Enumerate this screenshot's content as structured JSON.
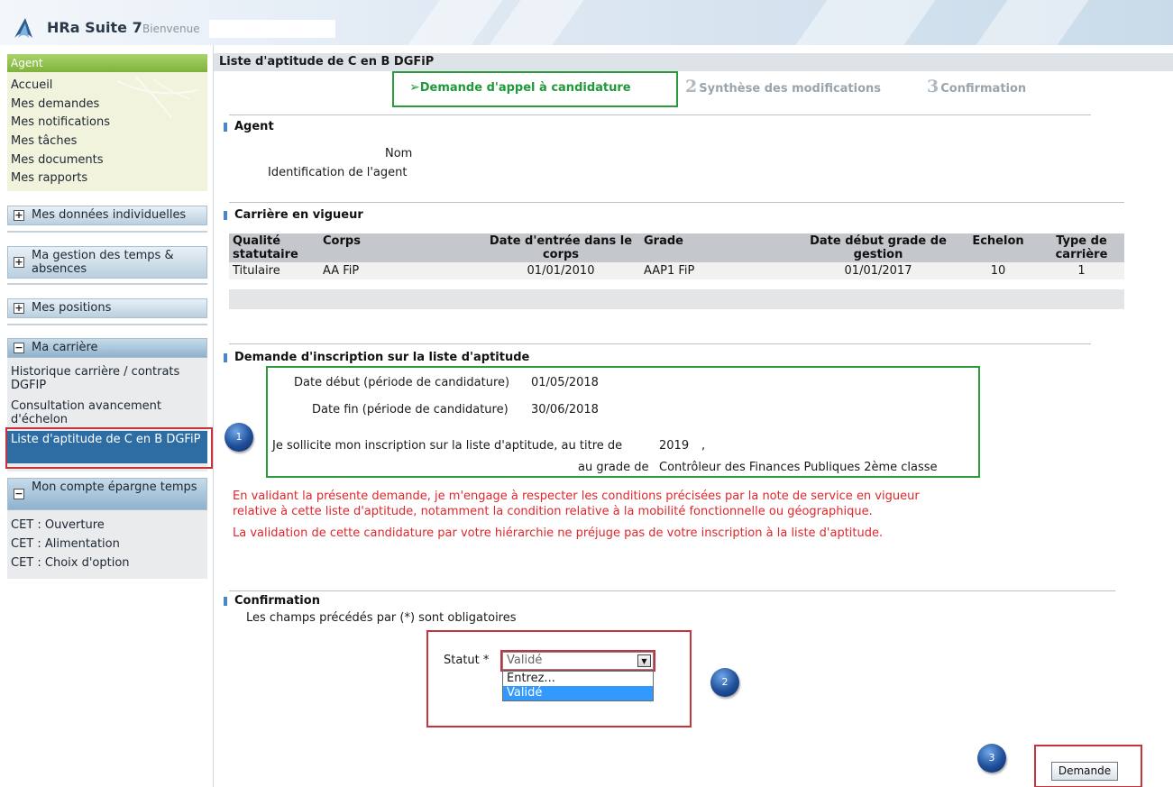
{
  "app": {
    "title": "HRa Suite",
    "version": "7",
    "welcome": "Bienvenue",
    "user": ""
  },
  "sidebar": {
    "agent_header": "Agent",
    "agent_links": [
      "Accueil",
      "Mes demandes",
      "Mes notifications",
      "Mes tâches",
      "Mes documents",
      "Mes rapports"
    ],
    "sections": {
      "donnees": {
        "label": "Mes données individuelles",
        "toggle": "+"
      },
      "temps": {
        "label": "Ma gestion des temps & absences",
        "toggle": "+"
      },
      "positions": {
        "label": "Mes positions",
        "toggle": "+"
      },
      "carriere": {
        "label": "Ma carrière",
        "toggle": "−",
        "items": [
          "Historique carrière / contrats DGFIP",
          "Consultation avancement d'échelon",
          "Liste d'aptitude de C en B DGFiP"
        ]
      },
      "cet": {
        "label": "Mon compte épargne temps",
        "toggle": "−",
        "items": [
          "CET : Ouverture",
          "CET : Alimentation",
          "CET : Choix d'option"
        ]
      }
    }
  },
  "page": {
    "title": "Liste d'aptitude de C en B DGFiP",
    "steps": [
      {
        "num": "1",
        "label": "Demande d'appel à candidature",
        "active": true
      },
      {
        "num": "2",
        "label": "Synthèse des modifications",
        "active": false
      },
      {
        "num": "3",
        "label": "Confirmation",
        "active": false
      }
    ]
  },
  "agent": {
    "title": "Agent",
    "nom_label": "Nom",
    "ident_label": "Identification de l'agent",
    "nom_value": "",
    "ident_value": ""
  },
  "career": {
    "title": "Carrière en vigueur",
    "columns": [
      "Qualité statutaire",
      "Corps",
      "Date d'entrée dans le corps",
      "Grade",
      "Date début grade de gestion",
      "Echelon",
      "Type de carrière"
    ],
    "rows": [
      [
        "Titulaire",
        "AA FiP",
        "01/01/2010",
        "AAP1 FiP",
        "01/01/2017",
        "10",
        "1"
      ]
    ]
  },
  "inscription": {
    "title": "Demande d'inscription sur la liste d'aptitude",
    "date_debut_label": "Date début (période de candidature)",
    "date_debut": "01/05/2018",
    "date_fin_label": "Date fin (période de candidature)",
    "date_fin": "30/06/2018",
    "sollicite_label": "Je sollicite mon inscription sur la liste d'aptitude, au titre de",
    "annee": "2019",
    "comma": ",",
    "grade_label": "au grade de",
    "grade": "Contrôleur des Finances Publiques 2ème classe",
    "warning_1_line1": "En validant la présente demande, je m'engage à respecter les conditions précisées par la note de service en vigueur",
    "warning_1_line2": "relative à cette liste d'aptitude, notamment la condition relative à la mobilité fonctionnelle ou géographique.",
    "warning_2": "La validation de cette candidature par votre hiérarchie ne préjuge pas de votre inscription à la liste d'aptitude."
  },
  "confirmation": {
    "title": "Confirmation",
    "mandatory_note": "Les champs précédés par (*) sont obligatoires",
    "statut_label": "Statut *",
    "statut_value": "Validé",
    "options": [
      "Entrez...",
      "Validé"
    ],
    "submit_label": "Demande"
  },
  "callouts": [
    "1",
    "2",
    "3"
  ],
  "colors": {
    "accent_blue": "#2e6da4",
    "agent_green": "#7fb23a",
    "step_active_green": "#1e9a3a",
    "highlight_green_border": "#2a9a3d",
    "highlight_red_border": "#c8323a",
    "warning_red": "#e0262b"
  }
}
